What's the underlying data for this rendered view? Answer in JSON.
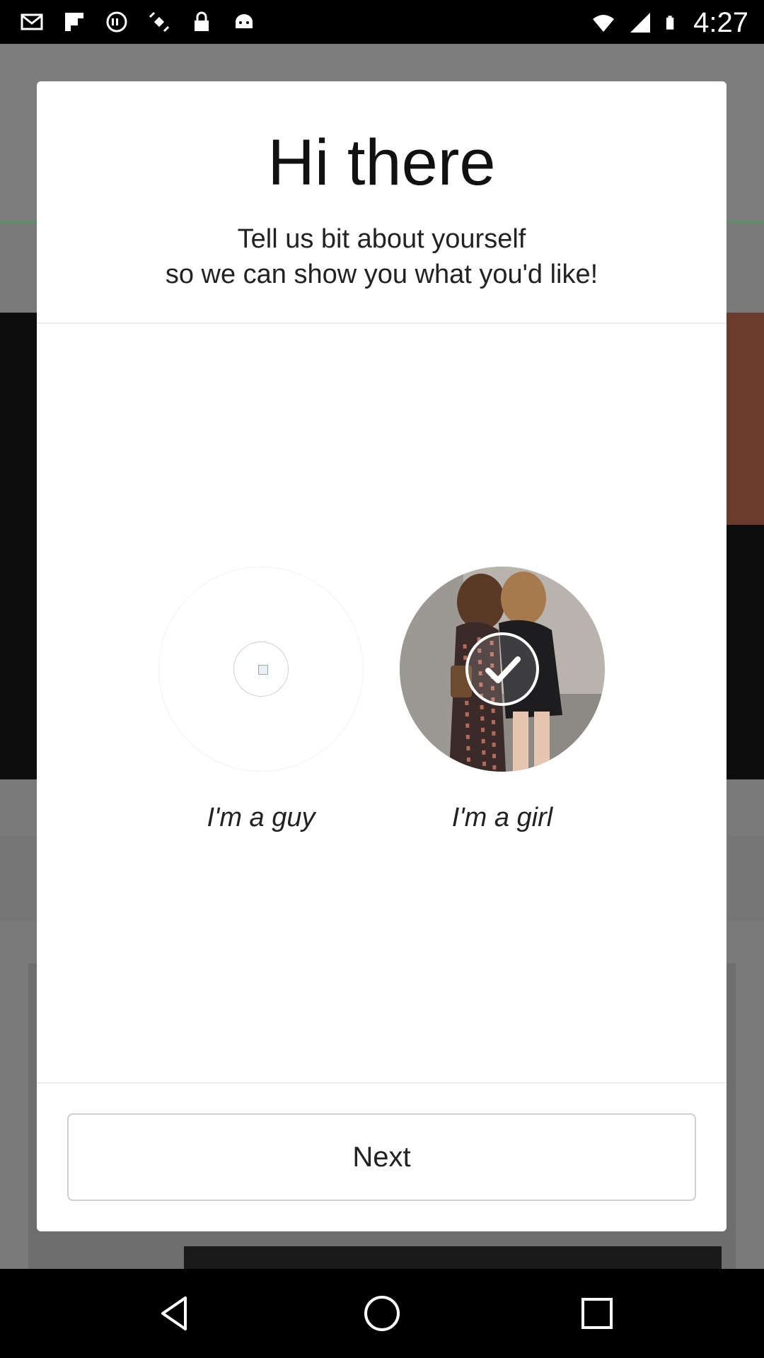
{
  "status_bar": {
    "time": "4:27",
    "icons_left": [
      "mail-icon",
      "flipboard-icon",
      "block-icon",
      "satellite-icon",
      "lock-icon",
      "android-icon"
    ],
    "icons_right": [
      "wifi-icon",
      "signal-icon",
      "battery-icon"
    ]
  },
  "dialog": {
    "title": "Hi there",
    "subtitle_line1": "Tell us bit about yourself",
    "subtitle_line2": "so we can show you what you'd like!",
    "options": [
      {
        "label": "I'm a guy",
        "selected": false
      },
      {
        "label": "I'm a girl",
        "selected": true
      }
    ],
    "next_label": "Next"
  },
  "nav_bar": {
    "icons": [
      "back-icon",
      "home-icon",
      "recents-icon"
    ]
  }
}
